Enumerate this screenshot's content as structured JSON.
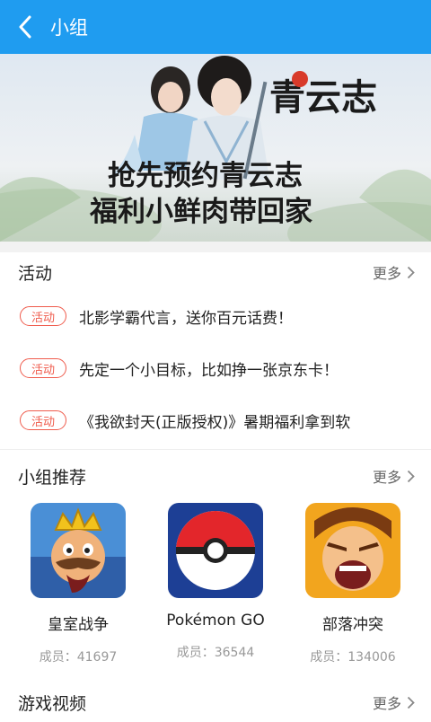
{
  "header": {
    "title": "小组"
  },
  "banner": {
    "headline_line1": "抢先预约青云志",
    "headline_line2": "福利小鲜肉带回家",
    "logo_text": "青云志"
  },
  "activities_section": {
    "title": "活动",
    "more_label": "更多",
    "items": [
      {
        "tag": "活动",
        "text": "北影学霸代言，送你百元话费！"
      },
      {
        "tag": "活动",
        "text": "先定一个小目标，比如挣一张京东卡！"
      },
      {
        "tag": "活动",
        "text": "《我欲封天(正版授权)》暑期福利拿到软"
      }
    ]
  },
  "groups_section": {
    "title": "小组推荐",
    "more_label": "更多",
    "items": [
      {
        "name": "皇室战争",
        "members": "成员：41697",
        "icon": "clash-royale-icon"
      },
      {
        "name": "Pokémon GO",
        "members": "成员：36544",
        "icon": "pokeball-icon"
      },
      {
        "name": "部落冲突",
        "members": "成员：134006",
        "icon": "clash-of-clans-icon"
      }
    ]
  },
  "videos_section": {
    "title": "游戏视频",
    "more_label": "更多"
  },
  "colors": {
    "header_bg": "#1f9cf0",
    "tag_red": "#ef5b4c"
  }
}
